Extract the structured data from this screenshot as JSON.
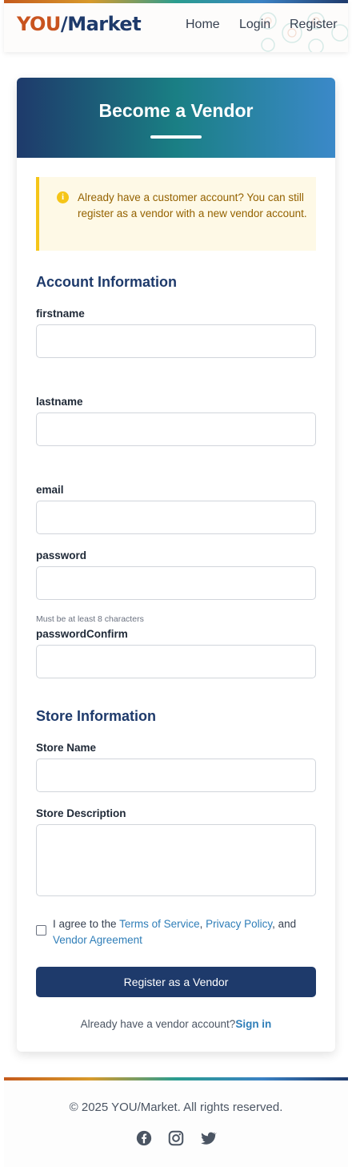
{
  "header": {
    "logo_part1": "YOU",
    "logo_part2": "/Market",
    "nav": [
      "Home",
      "Login",
      "Register"
    ]
  },
  "card": {
    "title": "Become a Vendor",
    "notice": "Already have a customer account? You can still register as a vendor with a new vendor account.",
    "account_section": "Account Information",
    "fields": {
      "firstname": "firstname",
      "lastname": "lastname",
      "email": "email",
      "password": "password",
      "password_hint": "Must be at least 8 characters",
      "password_confirm": "passwordConfirm"
    },
    "store_section": "Store Information",
    "store_fields": {
      "store_name": "Store Name",
      "store_description": "Store Description"
    },
    "agree": {
      "prefix": "I agree to the ",
      "terms": "Terms of Service",
      "sep1": ", ",
      "privacy": "Privacy Policy",
      "sep2": ", and ",
      "vendor": "Vendor Agreement"
    },
    "submit_label": "Register as a Vendor",
    "signin_prefix": "Already have a vendor account?",
    "signin_link": "Sign in"
  },
  "footer": {
    "copyright": "© 2025 YOU/Market. All rights reserved.",
    "social_icons": [
      "facebook-icon",
      "instagram-icon",
      "twitter-icon"
    ]
  },
  "colors": {
    "brand_navy": "#1e3a6b",
    "brand_orange": "#c9541f",
    "link_blue": "#2f7eb8",
    "notice_yellow": "#f5c518"
  }
}
